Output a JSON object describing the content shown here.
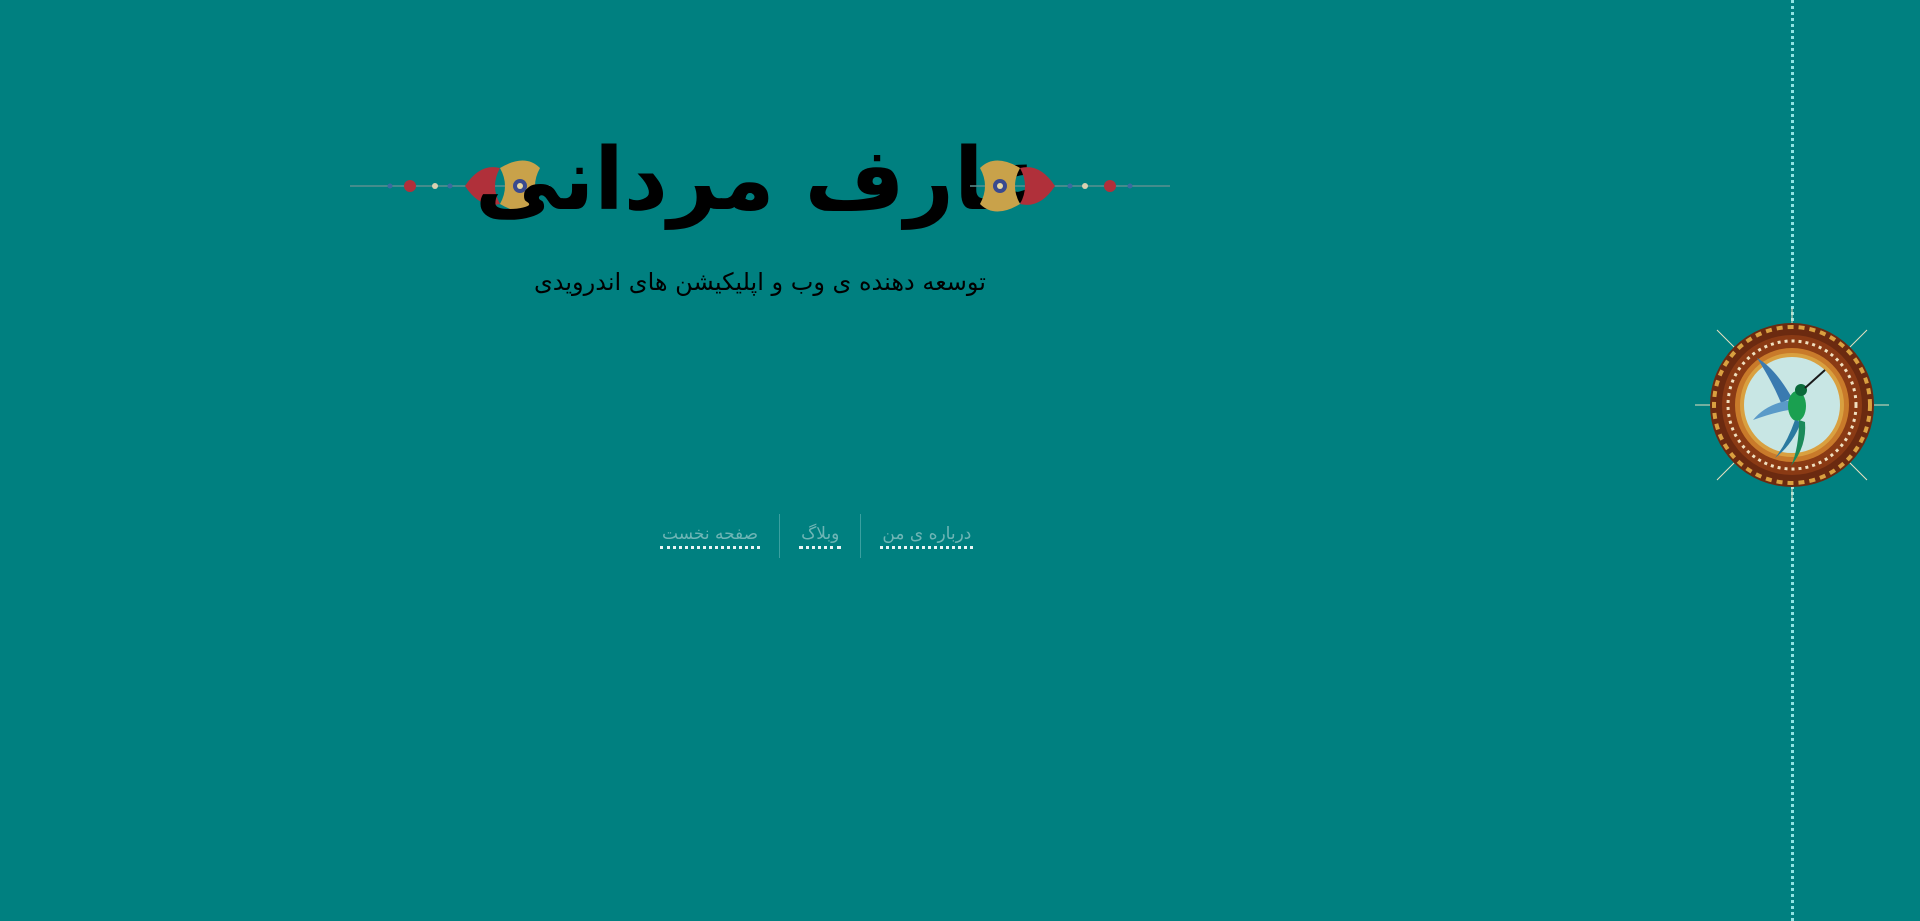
{
  "header": {
    "title": "عارف مردانی",
    "subtitle": "توسعه دهنده ی وب و اپلیکیشن های اندرویدی"
  },
  "nav": {
    "items": [
      {
        "label": "صفحه نخست"
      },
      {
        "label": "وبلاگ"
      },
      {
        "label": "درباره ی من"
      }
    ]
  },
  "icons": {
    "left_ornament": "floral-ornament-icon",
    "right_ornament": "floral-ornament-icon",
    "medallion": "hummingbird-medallion-icon"
  },
  "colors": {
    "background": "#008080",
    "title": "#000000",
    "nav_link": "#6eb5b5",
    "rail": "#8fe3e3"
  }
}
